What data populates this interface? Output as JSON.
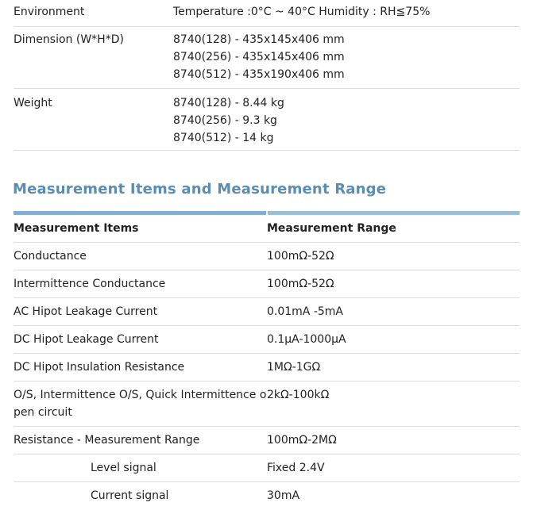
{
  "specs": [
    {
      "label": "Environment",
      "values": [
        "Temperature :0°C ~ 40°C  Humidity : RH≦75%"
      ]
    },
    {
      "label": "Dimension (W*H*D)",
      "values": [
        "8740(128) - 435x145x406 mm",
        "8740(256) - 435x145x406 mm",
        "8740(512) - 435x190x406 mm"
      ]
    },
    {
      "label": "Weight",
      "values": [
        "8740(128) - 8.44 kg",
        "8740(256) - 9.3 kg",
        "8740(512) - 14 kg"
      ]
    }
  ],
  "section_title": "Measurement Items and Measurement Range",
  "measure": {
    "header": {
      "item": "Measurement Items",
      "range": "Measurement Range"
    },
    "rows": [
      {
        "item": "Conductance",
        "range": "100mΩ-52Ω"
      },
      {
        "item": "Intermittence Conductance",
        "range": "100mΩ-52Ω"
      },
      {
        "item": "AC Hipot Leakage Current",
        "range": "0.01mA -5mA"
      },
      {
        "item": "DC Hipot Leakage Current",
        "range": "0.1μA-1000μA"
      },
      {
        "item": "DC Hipot Insulation Resistance",
        "range": "1MΩ-1GΩ"
      },
      {
        "item": "O/S, Intermittence O/S,  Quick Intermittence open circuit",
        "range": "2kΩ-100kΩ"
      },
      {
        "item": "Resistance - Measurement Range",
        "range": "100mΩ-2MΩ"
      },
      {
        "item": "Level signal",
        "range": "Fixed 2.4V"
      },
      {
        "item": "Current signal",
        "range": "30mA"
      }
    ]
  }
}
